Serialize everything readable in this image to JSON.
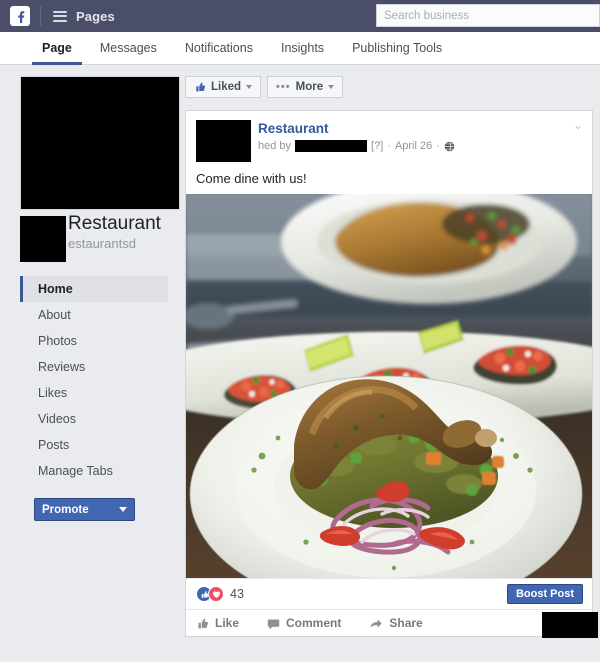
{
  "topbar": {
    "logo_icon": "facebook-logo-icon",
    "menu_icon": "hamburger-menu-icon",
    "section_label": "Pages",
    "search": {
      "placeholder": "Search business",
      "value": ""
    },
    "background_color": "#4a4e69"
  },
  "tabs": [
    {
      "label": "Page",
      "active": true
    },
    {
      "label": "Messages",
      "active": false
    },
    {
      "label": "Notifications",
      "active": false
    },
    {
      "label": "Insights",
      "active": false
    },
    {
      "label": "Publishing Tools",
      "active": false
    }
  ],
  "sidebar": {
    "cover_photo": "redacted-black-block",
    "page_avatar": "redacted-black-block",
    "page_name": "Restaurant",
    "page_username": "estaurantsd",
    "items": [
      {
        "label": "Home",
        "active": true
      },
      {
        "label": "About",
        "active": false
      },
      {
        "label": "Photos",
        "active": false
      },
      {
        "label": "Reviews",
        "active": false
      },
      {
        "label": "Likes",
        "active": false
      },
      {
        "label": "Videos",
        "active": false
      },
      {
        "label": "Posts",
        "active": false
      },
      {
        "label": "Manage Tabs",
        "active": false
      }
    ],
    "promote_label": "Promote",
    "promote_color": "#4267b2"
  },
  "actionbar": {
    "liked_label": "Liked",
    "liked_icon": "thumbs-up-icon",
    "more_label": "More",
    "more_icon": "ellipsis-icon"
  },
  "post": {
    "avatar": "redacted-black-block",
    "author": "Restaurant",
    "published_prefix": "hed by",
    "published_by": "redacted-black-block",
    "help_marker": "[?]",
    "separator": "·",
    "date": "April 26",
    "privacy_icon": "globe-icon",
    "menu_icon": "chevron-down-icon",
    "message": "Come dine with us!",
    "photo_alt": "restaurant-food-photo",
    "reactions": {
      "like_icon": "thumbs-up-reaction-icon",
      "love_icon": "heart-reaction-icon",
      "count": "43"
    },
    "boost_label": "Boost Post",
    "boost_color": "#4267b2",
    "footer_actions": [
      {
        "label": "Like",
        "icon": "thumbs-up-icon"
      },
      {
        "label": "Comment",
        "icon": "comment-icon"
      },
      {
        "label": "Share",
        "icon": "share-arrow-icon"
      }
    ],
    "footer_redaction": "redacted-black-block"
  }
}
